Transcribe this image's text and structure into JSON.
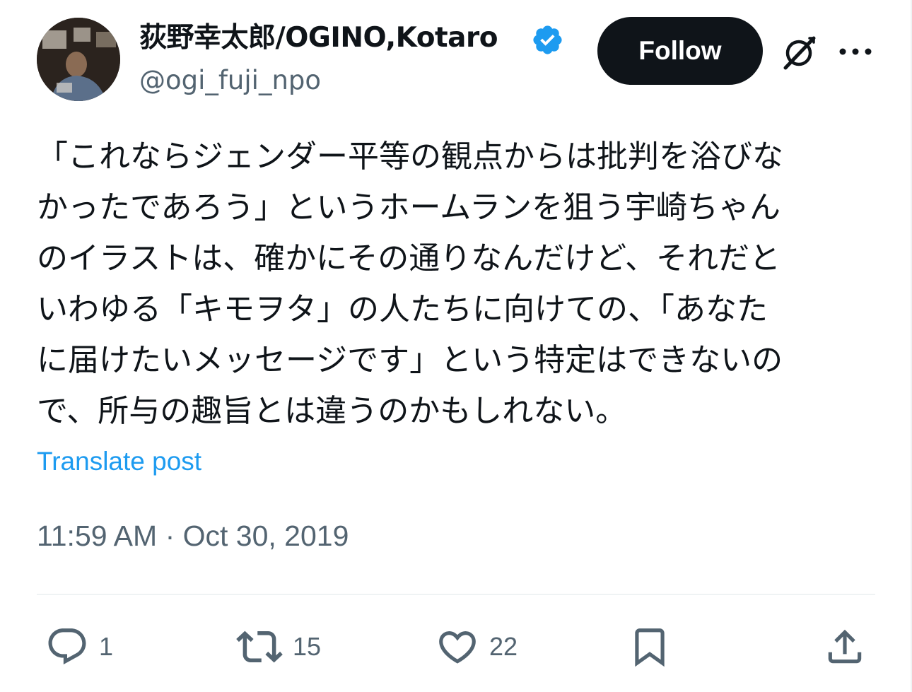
{
  "author": {
    "display_name": "荻野幸太郎/OGINO,Kotaro",
    "handle": "@ogi_fuji_npo",
    "verified": true
  },
  "header": {
    "follow_label": "Follow",
    "grok_icon": "grok-icon",
    "more_icon": "more-icon"
  },
  "tweet": {
    "lines": [
      "「これならジェンダー平等の観点からは批判を浴びな",
      "かったであろう」というホームランを狙う宇崎ちゃん",
      "のイラストは、確かにその通りなんだけど、それだと",
      "いわゆる「キモヲタ」の人たちに向けての、「あなた",
      "に届けたいメッセージです」という特定はできないの",
      "で、所与の趣旨とは違うのかもしれない。"
    ],
    "translate_label": "Translate post",
    "timestamp": "11:59 AM · Oct 30, 2019"
  },
  "actions": {
    "reply": {
      "icon": "reply-icon",
      "count": "1"
    },
    "retweet": {
      "icon": "retweet-icon",
      "count": "15"
    },
    "like": {
      "icon": "heart-icon",
      "count": "22"
    },
    "bookmark": {
      "icon": "bookmark-icon",
      "count": ""
    },
    "share": {
      "icon": "share-icon",
      "count": ""
    }
  },
  "colors": {
    "text_primary": "#0f1419",
    "text_secondary": "#536471",
    "link": "#1d9bf0",
    "verified_badge": "#1d9bf0",
    "follow_button_bg": "#0f1419",
    "divider": "#eff3f4"
  }
}
